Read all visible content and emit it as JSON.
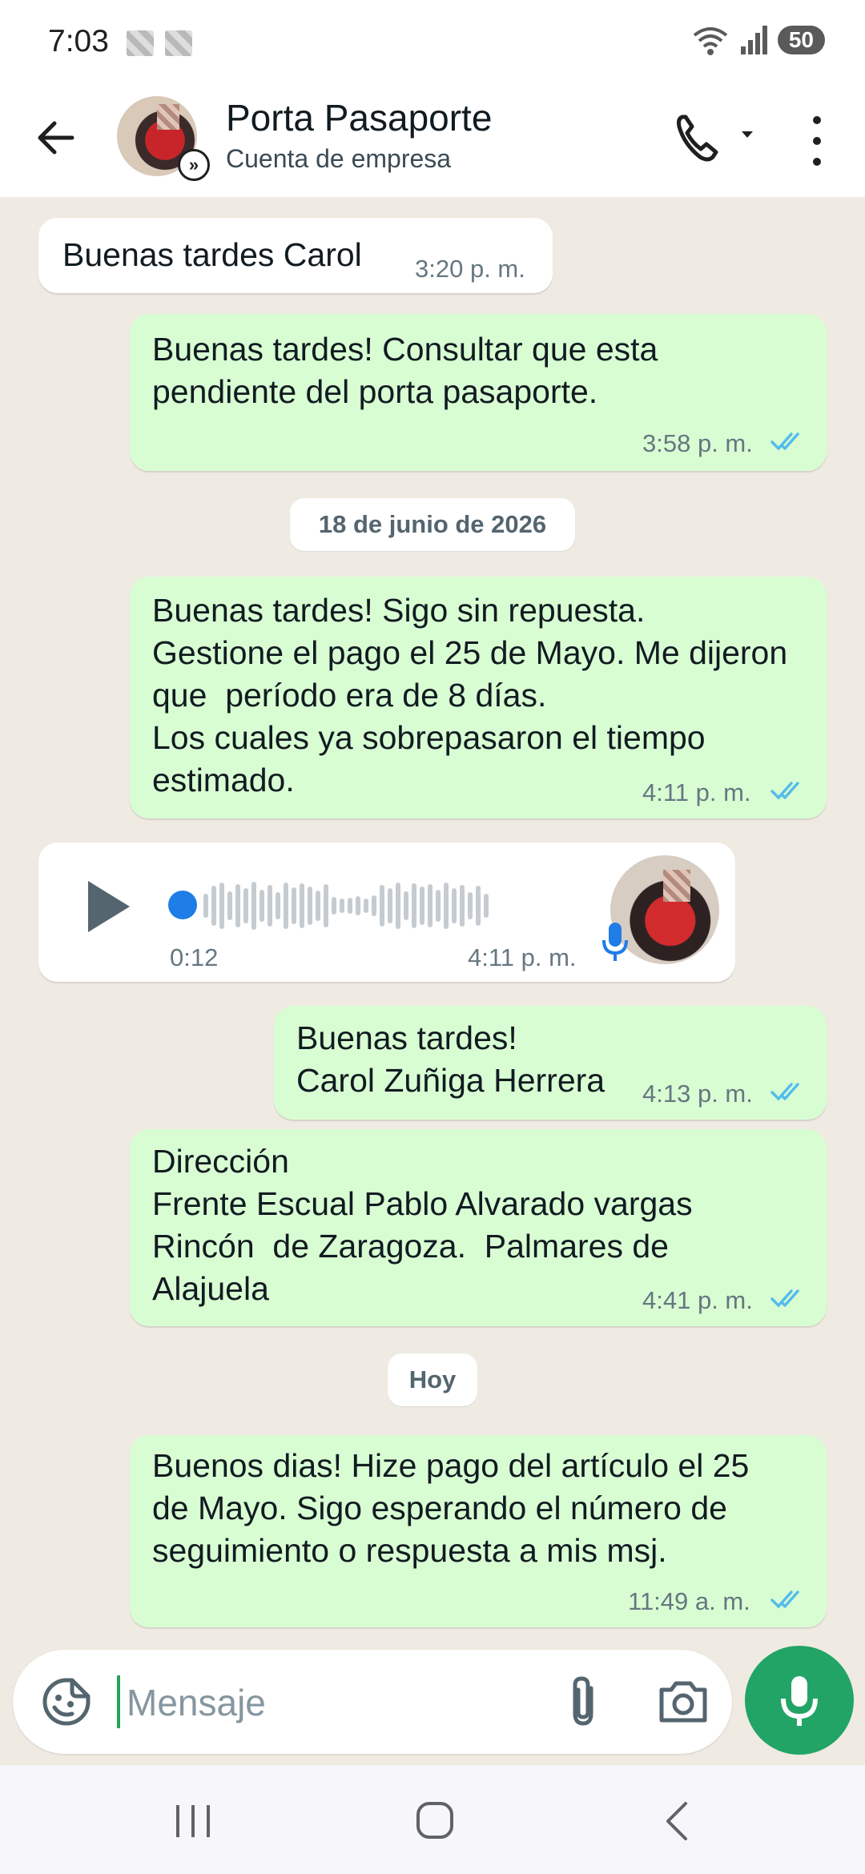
{
  "status_bar": {
    "time": "7:03",
    "battery": "50"
  },
  "header": {
    "name": "Porta Pasaporte",
    "subtitle": "Cuenta de empresa"
  },
  "messages": [
    {
      "text": "Buenas tardes Carol",
      "time": "3:20 p. m."
    },
    {
      "text": "Buenas tardes! Consultar que esta pendiente del porta pasaporte.",
      "time": "3:58 p. m."
    },
    {
      "text": "Buenas tardes! Sigo sin repuesta.\nGestione el pago el 25 de Mayo. Me dijeron que  período era de 8 días.\nLos cuales ya sobrepasaron el tiempo estimado.",
      "time": "4:11 p. m."
    },
    {
      "duration": "0:12",
      "time": "4:11 p. m."
    },
    {
      "text": "Buenas tardes!\nCarol Zuñiga Herrera",
      "time": "4:13 p. m."
    },
    {
      "text": "Dirección\nFrente Escual Pablo Alvarado vargas\nRincón  de Zaragoza.  Palmares de Alajuela",
      "time": "4:41 p. m."
    },
    {
      "text": "Buenos dias! Hize pago del artículo el 25 de Mayo. Sigo esperando el número de seguimiento o respuesta a mis msj.",
      "time": "11:49 a. m."
    }
  ],
  "dates": [
    "18 de junio de 2026",
    "Hoy"
  ],
  "composer": {
    "placeholder": "Mensaje"
  },
  "colors": {
    "outgoing_bubble": "#d9fdd3",
    "incoming_bubble": "#ffffff",
    "read_ticks": "#53bdeb",
    "accent": "#21a465"
  },
  "icons": [
    "back-arrow-icon",
    "business-badge-icon",
    "phone-icon",
    "dropdown-caret-icon",
    "more-vert-icon",
    "play-icon",
    "mic-icon",
    "emoji-icon",
    "attach-icon",
    "camera-icon",
    "recents-icon",
    "home-icon",
    "nav-back-icon"
  ]
}
